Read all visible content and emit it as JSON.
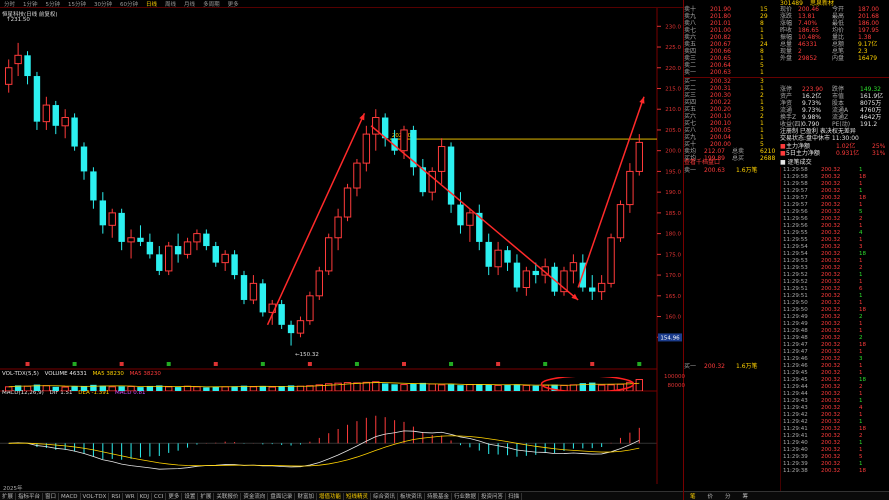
{
  "tabs": [
    "分时",
    "1分钟",
    "5分钟",
    "15分钟",
    "30分钟",
    "60分钟",
    "日线",
    "周线",
    "月线",
    "多周期",
    "更多"
  ],
  "active_tab": "日线",
  "stock_title": "恒星科技(日线 前复权)",
  "high_mark": "231.50",
  "low_mark": "150.32",
  "pivot_label": "202.80",
  "price_axis": [
    "230.0",
    "225.0",
    "220.0",
    "215.0",
    "210.0",
    "205.0",
    "200.0",
    "195.0",
    "190.0",
    "185.0",
    "180.0",
    "175.0",
    "170.0",
    "165.0",
    "160.0",
    "155.0"
  ],
  "last_price_badge": "154.96",
  "vol_title": {
    "name": "VOL-TDX(5,5)",
    "volume": "VOLUME 46331",
    "ma5": "MA5 38230",
    "ma10": "MA5 38230"
  },
  "vol_axis": [
    "100000",
    "80000",
    "60000",
    "40000",
    "20000",
    "×"
  ],
  "macd_title": {
    "name": "MACD(12,26,9)",
    "dif": "DIF 1.51",
    "dea": "DEA -1.391",
    "macd": "MACD 0.81"
  },
  "date_label": "2025年",
  "bottom_tabs": [
    "扩展",
    "指标平台",
    "窗口",
    "MACD",
    "VOL-TDX",
    "RSI",
    "WR",
    "KDJ",
    "CCI",
    "更多",
    "设置"
  ],
  "bottom_tabs2": [
    "扩展",
    "关联报价",
    "资金流向",
    "盘面记录",
    "财富加",
    "增值功能",
    "短线精灵",
    "综合资讯",
    "板块资讯",
    "持股基金",
    "行业数据",
    "投资问答",
    "扫描"
  ],
  "panel": {
    "code": "301489",
    "name": "思泉新材",
    "asks": [
      {
        "label": "卖十",
        "price": "201.90",
        "vol": "15"
      },
      {
        "label": "卖九",
        "price": "201.80",
        "vol": "29"
      },
      {
        "label": "卖八",
        "price": "201.01",
        "vol": "8"
      },
      {
        "label": "卖七",
        "price": "201.00",
        "vol": "1"
      },
      {
        "label": "卖六",
        "price": "200.82",
        "vol": "1"
      },
      {
        "label": "卖五",
        "price": "200.67",
        "vol": "24"
      },
      {
        "label": "卖四",
        "price": "200.66",
        "vol": "8"
      },
      {
        "label": "卖三",
        "price": "200.65",
        "vol": "1"
      },
      {
        "label": "卖二",
        "price": "200.64",
        "vol": "5"
      },
      {
        "label": "卖一",
        "price": "200.63",
        "vol": "1"
      }
    ],
    "bids": [
      {
        "label": "买一",
        "price": "200.32",
        "vol": "3"
      },
      {
        "label": "买二",
        "price": "200.31",
        "vol": "1"
      },
      {
        "label": "买三",
        "price": "200.30",
        "vol": "2"
      },
      {
        "label": "买四",
        "price": "200.22",
        "vol": "1"
      },
      {
        "label": "买五",
        "price": "200.20",
        "vol": "3"
      },
      {
        "label": "买六",
        "price": "200.10",
        "vol": "2"
      },
      {
        "label": "买七",
        "price": "200.10",
        "vol": "1"
      },
      {
        "label": "买八",
        "price": "200.05",
        "vol": "1"
      },
      {
        "label": "买九",
        "price": "200.04",
        "vol": "1"
      },
      {
        "label": "买十",
        "price": "200.00",
        "vol": "5"
      }
    ],
    "bid_total": {
      "l1": "卖均",
      "v1": "212.07",
      "l2": "总卖",
      "v2": "6210"
    },
    "ask_total": {
      "l1": "买均",
      "v1": "199.89",
      "l2": "总买",
      "v2": "2688"
    },
    "stats": [
      {
        "l": "现价",
        "v": "200.46",
        "l2": "今开",
        "v2": "187.00"
      },
      {
        "l": "涨跌",
        "v": "13.81",
        "l2": "最高",
        "v2": "201.68"
      },
      {
        "l": "涨幅",
        "v": "7.40%",
        "l2": "最低",
        "v2": "186.00"
      },
      {
        "l": "昨收",
        "v": "186.65",
        "l2": "均价",
        "v2": "197.95"
      },
      {
        "l": "振幅",
        "v": "10.48%",
        "l2": "量比",
        "v2": "1.38"
      },
      {
        "l": "总量",
        "v": "46331",
        "l2": "总额",
        "v2": "9.17亿"
      },
      {
        "l": "现量",
        "v": "2",
        "l2": "总笔",
        "v2": "2.3"
      },
      {
        "l": "外盘",
        "v": "29852",
        "l2": "内盘",
        "v2": "16479"
      }
    ],
    "stats2": [
      {
        "l": "涨停",
        "v": "223.90",
        "l2": "跌停",
        "v2": "149.32"
      },
      {
        "l": "资产",
        "v": "16.2亿",
        "l2": "市值",
        "v2": "161.9亿"
      },
      {
        "l": "净资",
        "v": "9.73%",
        "l2": "股本",
        "v2": "8075万"
      },
      {
        "l": "流通",
        "v": "9.73%",
        "l2": "流通A",
        "v2": "4760万"
      },
      {
        "l": "换手Z",
        "v": "9.98%",
        "l2": "流通Z",
        "v2": "4642万"
      },
      {
        "l": "收益(四)",
        "v": "0.790",
        "l2": "PE(动)",
        "v2": "191.2"
      }
    ],
    "notes": [
      "注册制 已盈利 表决权无差异",
      "交易状态:盘中休市 11:30:00"
    ],
    "flow": [
      {
        "l": "主力净额",
        "v": "1.02亿"
      },
      {
        "l": "5日主力净额",
        "v": "0.931亿"
      }
    ],
    "flow_pct": [
      "25%",
      "31%"
    ],
    "ticks_header": "逐笔成交",
    "lower_ask": {
      "label": "卖一",
      "price": "200.63",
      "vol": "1.6万笔"
    },
    "lower_bid": {
      "label": "买一",
      "price": "200.32",
      "vol": "1.6万笔"
    },
    "lower_note": "查看千档盘口",
    "ticks": [
      {
        "t": "11:29:58",
        "p": "200.32",
        "v": "1"
      },
      {
        "t": "11:29:58",
        "p": "200.32",
        "v": "18"
      },
      {
        "t": "11:29:58",
        "p": "200.32",
        "v": "1"
      },
      {
        "t": "11:29:57",
        "p": "200.32",
        "v": "1"
      },
      {
        "t": "11:29:57",
        "p": "200.32",
        "v": "18"
      },
      {
        "t": "11:29:57",
        "p": "200.32",
        "v": "1"
      },
      {
        "t": "11:29:56",
        "p": "200.32",
        "v": "5"
      },
      {
        "t": "11:29:56",
        "p": "200.32",
        "v": "2"
      },
      {
        "t": "11:29:56",
        "p": "200.32",
        "v": "1"
      },
      {
        "t": "11:29:55",
        "p": "200.32",
        "v": "4"
      },
      {
        "t": "11:29:55",
        "p": "200.32",
        "v": "1"
      },
      {
        "t": "11:29:54",
        "p": "200.32",
        "v": "3"
      },
      {
        "t": "11:29:54",
        "p": "200.32",
        "v": "18"
      },
      {
        "t": "11:29:53",
        "p": "200.32",
        "v": "1"
      },
      {
        "t": "11:29:53",
        "p": "200.32",
        "v": "2"
      },
      {
        "t": "11:29:52",
        "p": "200.32",
        "v": "1"
      },
      {
        "t": "11:29:52",
        "p": "200.32",
        "v": "1"
      },
      {
        "t": "11:29:51",
        "p": "200.32",
        "v": "6"
      },
      {
        "t": "11:29:51",
        "p": "200.32",
        "v": "1"
      },
      {
        "t": "11:29:50",
        "p": "200.32",
        "v": "1"
      },
      {
        "t": "11:29:50",
        "p": "200.32",
        "v": "18"
      },
      {
        "t": "11:29:49",
        "p": "200.32",
        "v": "2"
      },
      {
        "t": "11:29:49",
        "p": "200.32",
        "v": "1"
      },
      {
        "t": "11:29:48",
        "p": "200.32",
        "v": "1"
      },
      {
        "t": "11:29:48",
        "p": "200.32",
        "v": "2"
      },
      {
        "t": "11:29:47",
        "p": "200.32",
        "v": "18"
      },
      {
        "t": "11:29:47",
        "p": "200.32",
        "v": "1"
      },
      {
        "t": "11:29:46",
        "p": "200.32",
        "v": "3"
      },
      {
        "t": "11:29:46",
        "p": "200.32",
        "v": "1"
      },
      {
        "t": "11:29:45",
        "p": "200.32",
        "v": "1"
      },
      {
        "t": "11:29:45",
        "p": "200.32",
        "v": "18"
      },
      {
        "t": "11:29:44",
        "p": "200.32",
        "v": "2"
      },
      {
        "t": "11:29:44",
        "p": "200.32",
        "v": "1"
      },
      {
        "t": "11:29:43",
        "p": "200.32",
        "v": "1"
      },
      {
        "t": "11:29:43",
        "p": "200.32",
        "v": "4"
      },
      {
        "t": "11:29:42",
        "p": "200.32",
        "v": "1"
      },
      {
        "t": "11:29:42",
        "p": "200.32",
        "v": "1"
      },
      {
        "t": "11:29:41",
        "p": "200.32",
        "v": "18"
      },
      {
        "t": "11:29:41",
        "p": "200.32",
        "v": "2"
      },
      {
        "t": "11:29:40",
        "p": "200.32",
        "v": "1"
      },
      {
        "t": "11:29:40",
        "p": "200.32",
        "v": "1"
      },
      {
        "t": "11:29:39",
        "p": "200.32",
        "v": "5"
      },
      {
        "t": "11:29:39",
        "p": "200.32",
        "v": "1"
      },
      {
        "t": "11:29:38",
        "p": "200.32",
        "v": "18"
      }
    ],
    "bottom_tabs": [
      "笔",
      "价",
      "分",
      "筹"
    ]
  },
  "colors": {
    "up": "#ff3b3b",
    "down": "#2cf0f0",
    "ma": "#ffd200",
    "accent": "#ff2a2a"
  },
  "chart_data": {
    "type": "candlestick",
    "ylim": [
      150,
      232
    ],
    "candles": [
      [
        216,
        222,
        214,
        220
      ],
      [
        221,
        226,
        218,
        223
      ],
      [
        223,
        224,
        216,
        218
      ],
      [
        218,
        219,
        205,
        207
      ],
      [
        207,
        213,
        205,
        211
      ],
      [
        211,
        212,
        204,
        206
      ],
      [
        206,
        210,
        203,
        208
      ],
      [
        208,
        209,
        200,
        201
      ],
      [
        201,
        202,
        193,
        195
      ],
      [
        195,
        196,
        186,
        188
      ],
      [
        188,
        190,
        180,
        182
      ],
      [
        182,
        186,
        179,
        185
      ],
      [
        185,
        186,
        176,
        178
      ],
      [
        178,
        181,
        174,
        179
      ],
      [
        179,
        182,
        177,
        178
      ],
      [
        178,
        180,
        174,
        175
      ],
      [
        175,
        177,
        170,
        171
      ],
      [
        171,
        178,
        170,
        177
      ],
      [
        177,
        180,
        173,
        175
      ],
      [
        175,
        179,
        174,
        178
      ],
      [
        178,
        181,
        176,
        180
      ],
      [
        180,
        181,
        176,
        177
      ],
      [
        177,
        178,
        172,
        173
      ],
      [
        173,
        176,
        171,
        175
      ],
      [
        175,
        176,
        169,
        170
      ],
      [
        170,
        171,
        163,
        164
      ],
      [
        164,
        170,
        163,
        168
      ],
      [
        168,
        169,
        160,
        161
      ],
      [
        161,
        164,
        158,
        163
      ],
      [
        163,
        164,
        157,
        158
      ],
      [
        158,
        159,
        153,
        156
      ],
      [
        156,
        160,
        155,
        159
      ],
      [
        159,
        166,
        158,
        165
      ],
      [
        165,
        172,
        164,
        171
      ],
      [
        171,
        180,
        170,
        179
      ],
      [
        179,
        186,
        176,
        184
      ],
      [
        184,
        192,
        183,
        191
      ],
      [
        191,
        198,
        189,
        197
      ],
      [
        197,
        206,
        195,
        204
      ],
      [
        204,
        210,
        200,
        208
      ],
      [
        208,
        209,
        201,
        203
      ],
      [
        203,
        205,
        199,
        200
      ],
      [
        200,
        206,
        198,
        205
      ],
      [
        205,
        206,
        194,
        196
      ],
      [
        196,
        198,
        189,
        190
      ],
      [
        190,
        196,
        188,
        195
      ],
      [
        195,
        203,
        192,
        201
      ],
      [
        201,
        202,
        185,
        187
      ],
      [
        187,
        190,
        180,
        182
      ],
      [
        182,
        186,
        178,
        185
      ],
      [
        185,
        187,
        176,
        178
      ],
      [
        178,
        180,
        170,
        172
      ],
      [
        172,
        178,
        170,
        176
      ],
      [
        176,
        177,
        171,
        173
      ],
      [
        173,
        175,
        166,
        167
      ],
      [
        167,
        172,
        165,
        171
      ],
      [
        171,
        173,
        168,
        170
      ],
      [
        170,
        174,
        168,
        172
      ],
      [
        172,
        173,
        165,
        166
      ],
      [
        166,
        172,
        165,
        171
      ],
      [
        171,
        175,
        168,
        173
      ],
      [
        173,
        175,
        166,
        167
      ],
      [
        167,
        170,
        164,
        166
      ],
      [
        166,
        170,
        164,
        168
      ],
      [
        168,
        180,
        167,
        179
      ],
      [
        179,
        188,
        178,
        187
      ],
      [
        187,
        197,
        185,
        195
      ],
      [
        195,
        204,
        194,
        202
      ]
    ],
    "volume": [
      30,
      40,
      34,
      46,
      38,
      30,
      28,
      32,
      36,
      44,
      38,
      30,
      34,
      32,
      28,
      36,
      40,
      30,
      28,
      34,
      30,
      26,
      32,
      30,
      34,
      38,
      30,
      36,
      28,
      32,
      40,
      34,
      38,
      44,
      52,
      56,
      60,
      58,
      62,
      66,
      54,
      48,
      46,
      52,
      58,
      50,
      44,
      48,
      42,
      46,
      50,
      44,
      40,
      44,
      48,
      40,
      38,
      42,
      46,
      40,
      44,
      56,
      60,
      42,
      44,
      48,
      62,
      82
    ],
    "vol_color_up": [
      1,
      0,
      1,
      0,
      1,
      0,
      1,
      0,
      0,
      0,
      0,
      1,
      0,
      1,
      0,
      0,
      0,
      1,
      0,
      1,
      1,
      0,
      0,
      1,
      0,
      0,
      1,
      0,
      1,
      0,
      0,
      1,
      1,
      1,
      1,
      1,
      1,
      1,
      1,
      1,
      0,
      0,
      1,
      0,
      0,
      1,
      1,
      0,
      0,
      1,
      0,
      0,
      1,
      0,
      0,
      1,
      0,
      1,
      0,
      1,
      1,
      0,
      0,
      1,
      1,
      1,
      1,
      1
    ]
  }
}
